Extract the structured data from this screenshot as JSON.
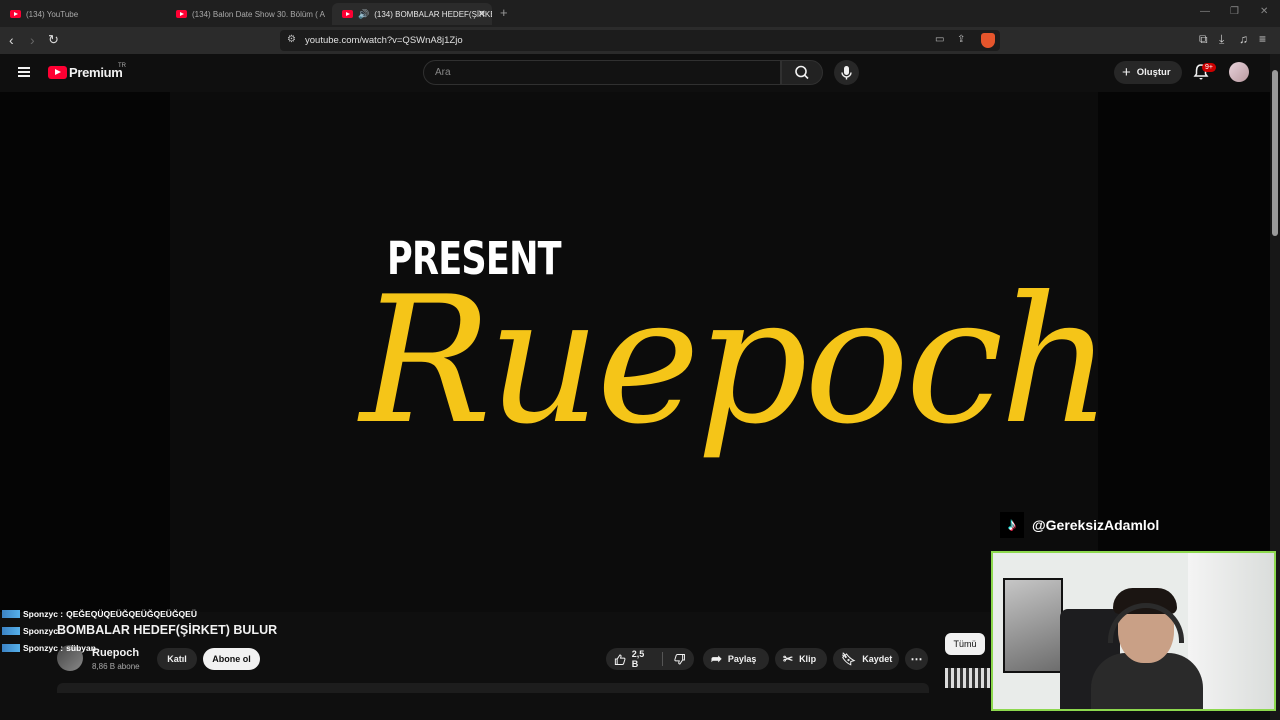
{
  "browser": {
    "tabs": [
      {
        "title": "(134) YouTube",
        "active": false
      },
      {
        "title": "(134) Balon Date Show 30. Bölüm ( A",
        "active": false
      },
      {
        "title": "(134) BOMBALAR HEDEF(ŞİRKE",
        "active": true
      }
    ],
    "url": "youtube.com/watch?v=QSWnA8j1Zjo"
  },
  "youtube": {
    "logo_text": "Premium",
    "country_code": "TR",
    "search_placeholder": "Ara",
    "create_label": "Oluştur",
    "notification_count": "9+"
  },
  "video": {
    "overlay_word": "PRESENT",
    "overlay_script": "Ruepoch",
    "tiktok_handle": "@GereksizAdamlol"
  },
  "chat": [
    {
      "user": "Sponzyc :",
      "message": "QEĞEQÜQEÜĞQEÜĞQEÜĞQEÜ"
    },
    {
      "user": "Sponzyc :",
      "message": ""
    },
    {
      "user": "Sponzyc :",
      "message": "sübyan"
    }
  ],
  "info": {
    "title": "BOMBALAR HEDEF(ŞİRKET) BULUR",
    "channel_name": "Ruepoch",
    "subscribers": "8,86 B abone",
    "join_label": "Katıl",
    "subscribe_label": "Abone ol",
    "like_count": "2,5 B",
    "share_label": "Paylaş",
    "clip_label": "Klip",
    "save_label": "Kaydet",
    "filter_chip": "Tümü"
  },
  "colors": {
    "accent_red": "#ff0033",
    "script_yellow": "#f5c518",
    "webcam_border": "#8dd84e"
  }
}
